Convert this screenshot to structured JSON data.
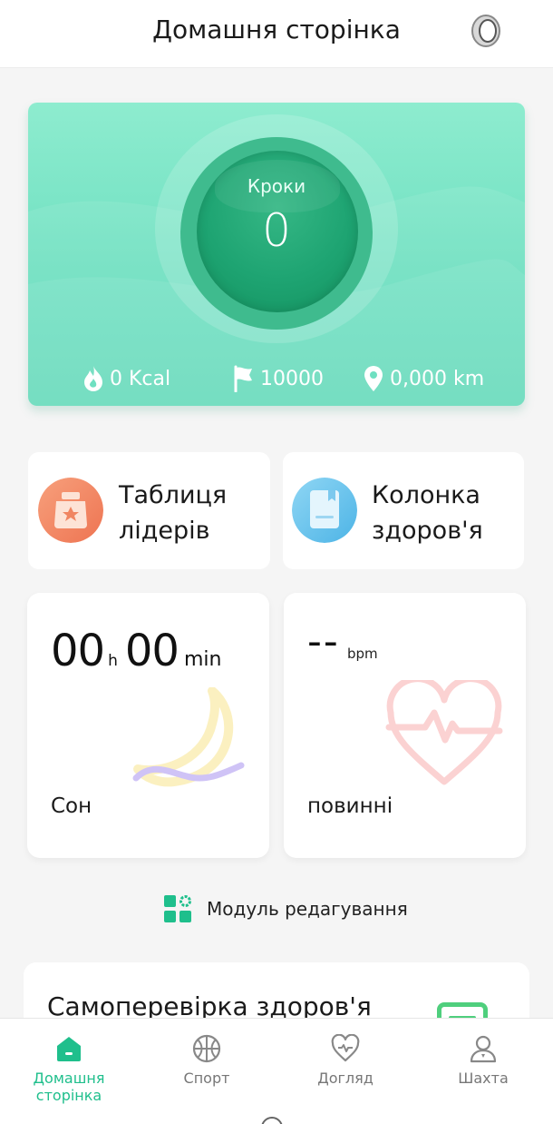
{
  "header": {
    "title": "Домашня сторінка",
    "ring_icon": "ring-device-icon"
  },
  "steps": {
    "label": "Кроки",
    "value": "0",
    "calories": "0 Kcal",
    "goal": "10000",
    "distance": "0,000 km",
    "colors": {
      "card": "#6fe0c1",
      "circle": "#1ea472"
    }
  },
  "tiles": {
    "leaderboard": {
      "label": "Таблиця лідерів",
      "line1": "Таблиця",
      "line2": "лідерів",
      "icon": "leaderboard-medal-icon"
    },
    "health_column": {
      "label": "Колонка здоров'я",
      "line1": "Колонка",
      "line2": "здоров'я",
      "icon": "health-column-notebook-icon"
    }
  },
  "sleep": {
    "hours": "00",
    "hours_unit": "h",
    "minutes": "00",
    "minutes_unit": "min",
    "label": "Сон",
    "icon": "moon-icon"
  },
  "heart": {
    "value": "--",
    "unit": "bpm",
    "label": "повинні",
    "icon": "heart-rate-icon"
  },
  "edit_module": {
    "label": "Модуль редагування",
    "icon": "grid-gear-icon"
  },
  "selfcheck": {
    "title": "Самоперевірка здоров'я",
    "icon": "monitor-icon"
  },
  "tabbar": {
    "active": "home",
    "accent": "#1fbf8c",
    "items": [
      {
        "label": "Домашня сторінка",
        "icon": "home-icon"
      },
      {
        "label": "Спорт",
        "icon": "basketball-icon"
      },
      {
        "label": "Догляд",
        "icon": "heart-pulse-icon"
      },
      {
        "label": "Шахта",
        "icon": "user-icon"
      }
    ]
  }
}
